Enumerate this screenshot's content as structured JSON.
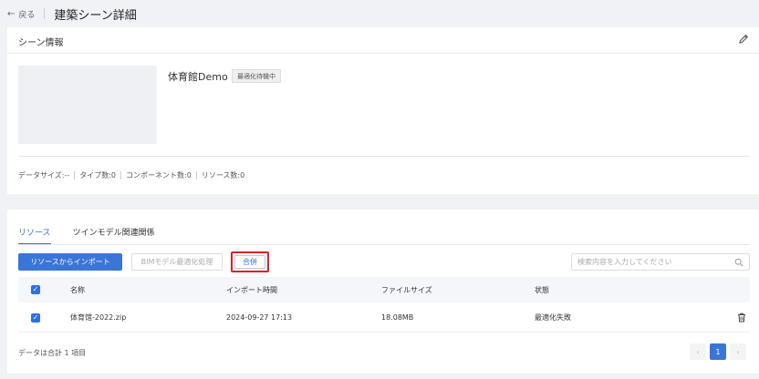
{
  "header": {
    "back_label": "戻る",
    "page_title": "建築シーン詳細"
  },
  "scene_info": {
    "section_title": "シーン情報",
    "scene_name": "体育館Demo",
    "status_badge": "最適化待機中",
    "stats": [
      "データサイズ:--",
      "タイプ数:0",
      "コンポーネント数:0",
      "リソース数:0"
    ]
  },
  "tabs": [
    {
      "label": "リソース",
      "active": true
    },
    {
      "label": "ツインモデル関連関係",
      "active": false
    }
  ],
  "toolbar": {
    "import_label": "リソースからインポート",
    "bim_optimize_label": "BIMモデル最適化処理",
    "merge_label": "合併"
  },
  "search": {
    "placeholder": "検索内容を入力してください",
    "value": ""
  },
  "table": {
    "columns": [
      "名称",
      "インポート時間",
      "ファイルサイズ",
      "状態"
    ],
    "rows": [
      {
        "name": "体育馆-2022.zip",
        "import_time": "2024-09-27 17:13",
        "file_size": "18.08MB",
        "status": "最適化失敗"
      }
    ]
  },
  "footer": {
    "total_text": "データは合計 1 項目",
    "current_page": "1",
    "prev_symbol": "‹",
    "next_symbol": "›"
  },
  "colors": {
    "accent": "#2e6ee6",
    "primary_button": "#3a75d8",
    "highlight_border": "#e02020"
  },
  "icons": {
    "back": "arrow-left-icon",
    "edit": "pencil-icon",
    "search": "search-icon",
    "delete": "trash-icon",
    "checkbox": "check-icon"
  }
}
